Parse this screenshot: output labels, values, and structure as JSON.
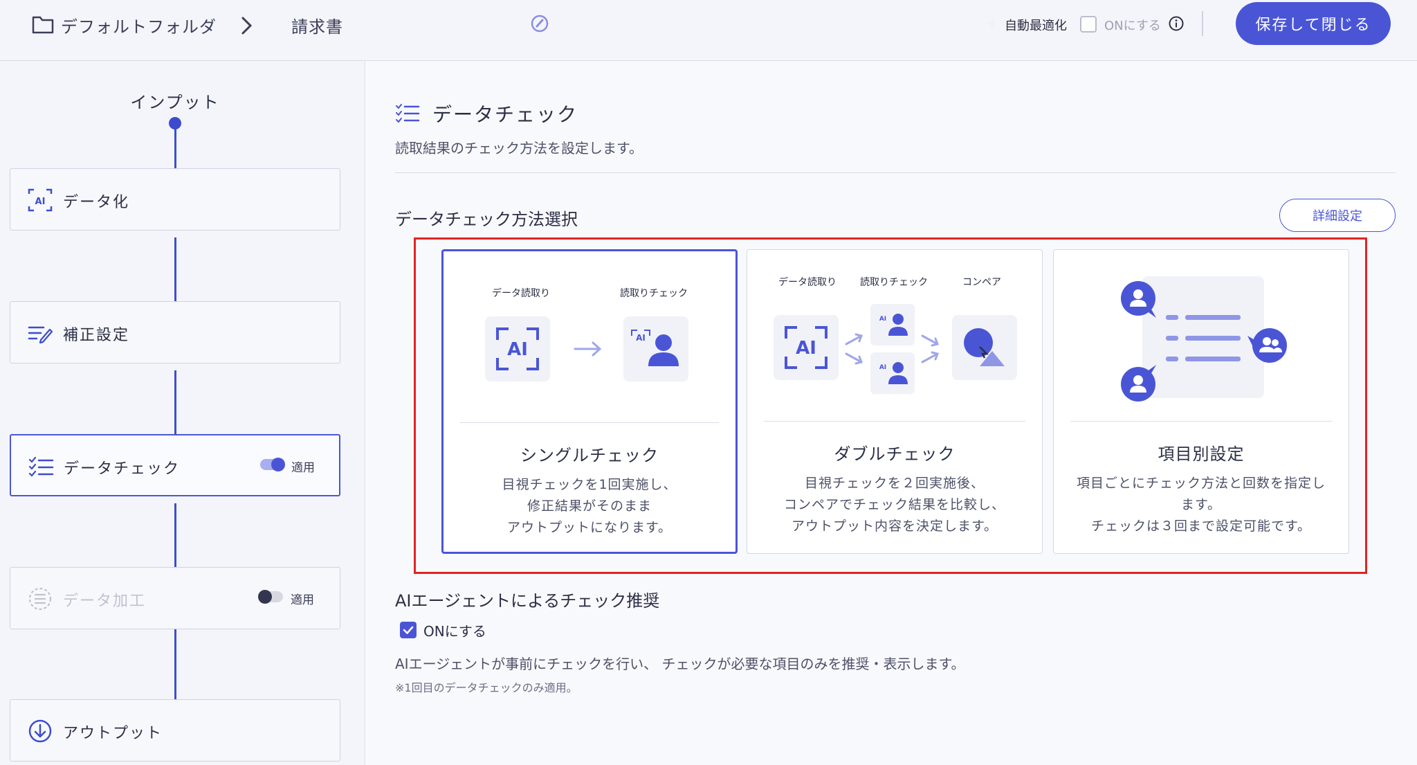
{
  "header": {
    "breadcrumb_folder": "デフォルトフォルダ",
    "breadcrumb_doc": "請求書",
    "auto_optimize_label": "自動最適化",
    "auto_optimize_on_label": "ONにする",
    "save_close_label": "保存して閉じる"
  },
  "sidebar": {
    "input_label": "インプット",
    "steps": [
      {
        "label": "データ化",
        "icon": "ai-scan-icon"
      },
      {
        "label": "補正設定",
        "icon": "edit-list-icon"
      },
      {
        "label": "データチェック",
        "icon": "checklist-icon",
        "toggle_label": "適用",
        "toggle_on": true,
        "active": true
      },
      {
        "label": "データ加工",
        "icon": "process-icon",
        "toggle_label": "適用",
        "toggle_on": false,
        "disabled": true
      },
      {
        "label": "アウトプット",
        "icon": "download-icon"
      }
    ]
  },
  "main": {
    "section_title": "データチェック",
    "section_desc": "読取結果のチェック方法を設定します。",
    "method_title": "データチェック方法選択",
    "detail_button": "詳細設定",
    "cards": [
      {
        "title": "シングルチェック",
        "desc": [
          "目視チェックを1回実施し、",
          "修正結果がそのまま",
          "アウトプットになります。"
        ],
        "labels": [
          "データ読取り",
          "読取りチェック"
        ],
        "selected": true
      },
      {
        "title": "ダブルチェック",
        "desc": [
          "目視チェックを２回実施後、",
          "コンペアでチェック結果を比較し、",
          "アウトプット内容を決定します。"
        ],
        "labels": [
          "データ読取り",
          "読取りチェック",
          "コンペア"
        ],
        "selected": false
      },
      {
        "title": "項目別設定",
        "desc": [
          "項目ごとにチェック方法と回数を指定し",
          "ます。",
          "チェックは３回まで設定可能です。"
        ],
        "selected": false
      }
    ],
    "ai_text": "AI",
    "agent_title": "AIエージェントによるチェック推奨",
    "agent_on_label": "ONにする",
    "agent_checked": true,
    "agent_desc": "AIエージェントが事前にチェックを行い、 チェックが必要な項目のみを推奨・表示します。",
    "agent_note": "※1回目のデータチェックのみ適用。"
  },
  "colors": {
    "accent": "#4a55d6",
    "flow_line": "#3d4ccf",
    "highlight_border": "#e02424",
    "illus_light": "#f1f2f8",
    "toggle_on": "#4a55d6",
    "toggle_off": "#c4c6d4"
  }
}
